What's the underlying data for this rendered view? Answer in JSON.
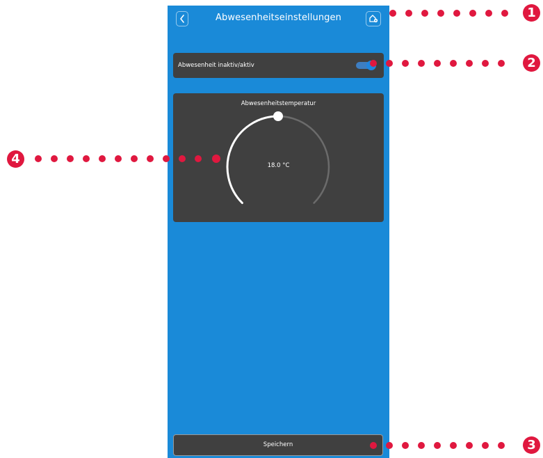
{
  "header": {
    "back_icon": "chevron-left-icon",
    "title": "Abwesenheitseinstellungen",
    "home_icon": "home-settings-icon"
  },
  "absence": {
    "label": "Abwesenheit inaktiv/aktiv",
    "active": true
  },
  "temperature": {
    "title": "Abwesenheitstemperatur",
    "value": "18.0 °C",
    "dial_level": 0.5
  },
  "footer": {
    "save_label": "Speichern"
  },
  "callouts": {
    "c1": "1",
    "c2": "2",
    "c3": "3",
    "c4": "4"
  },
  "colors": {
    "background": "#1a8ad8",
    "card": "#404040",
    "accent": "#1f86e0",
    "callout": "#e0183f"
  }
}
